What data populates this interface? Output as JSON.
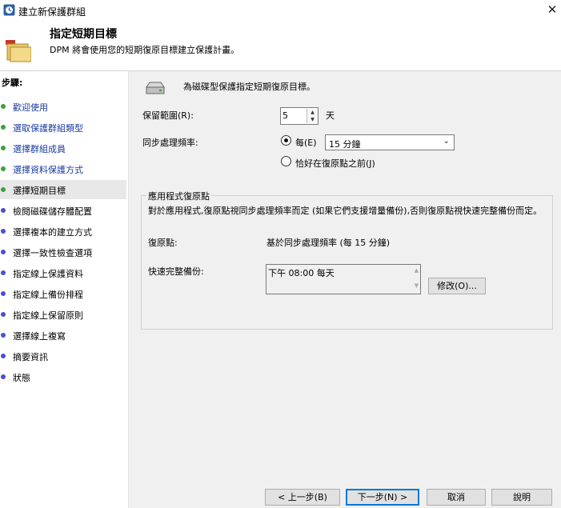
{
  "window": {
    "title": "建立新保護群組",
    "close_glyph": "✕"
  },
  "header": {
    "title": "指定短期目標",
    "description": "DPM 將會使用您的短期復原目標建立保護計畫。",
    "icon": "protection-group-folder-icon"
  },
  "sidebar": {
    "steps_label": "步驟:",
    "items": [
      {
        "label": "歡迎使用",
        "state": "done"
      },
      {
        "label": "選取保護群組類型",
        "state": "done"
      },
      {
        "label": "選擇群組成員",
        "state": "done"
      },
      {
        "label": "選擇資料保護方式",
        "state": "done"
      },
      {
        "label": "選擇短期目標",
        "state": "current"
      },
      {
        "label": "檢閱磁碟儲存體配置",
        "state": "pending"
      },
      {
        "label": "選擇複本的建立方式",
        "state": "pending"
      },
      {
        "label": "選擇一致性檢查選項",
        "state": "pending"
      },
      {
        "label": "指定線上保護資料",
        "state": "pending"
      },
      {
        "label": "指定線上備份排程",
        "state": "pending"
      },
      {
        "label": "指定線上保留原則",
        "state": "pending"
      },
      {
        "label": "選擇線上複寫",
        "state": "pending"
      },
      {
        "label": "摘要資訊",
        "state": "pending"
      },
      {
        "label": "狀態",
        "state": "pending"
      }
    ]
  },
  "main": {
    "intro": "為磁碟型保護指定短期復原目標。",
    "retention": {
      "label": "保留範圍(R):",
      "value": "5",
      "unit": "天"
    },
    "sync": {
      "label": "同步處理頻率:",
      "option_every": "每(E)",
      "frequency": "15 分鐘",
      "option_before": "恰好在復原點之前(J)",
      "selected": "every"
    },
    "app_recovery": {
      "group_title": "應用程式復原點",
      "description": "對於應用程式,復原點視同步處理頻率而定 (如果它們支援增量備份),否則復原點視快速完整備份而定。",
      "recovery_points_label": "復原點:",
      "recovery_points_value": "基於同步處理頻率 (每 15 分鐘)",
      "full_backup_label": "快速完整備份:",
      "full_backup_value": "下午 08:00 每天",
      "modify_button": "修改(O)..."
    }
  },
  "footer": {
    "back": "< 上一步(B)",
    "next": "下一步(N) >",
    "cancel": "取消",
    "help": "說明"
  },
  "colors": {
    "done_dot": "#3ba13b",
    "pending_dot": "#4a4fd1",
    "done_text": "#1a3aa0",
    "accent": "#0078d7"
  }
}
